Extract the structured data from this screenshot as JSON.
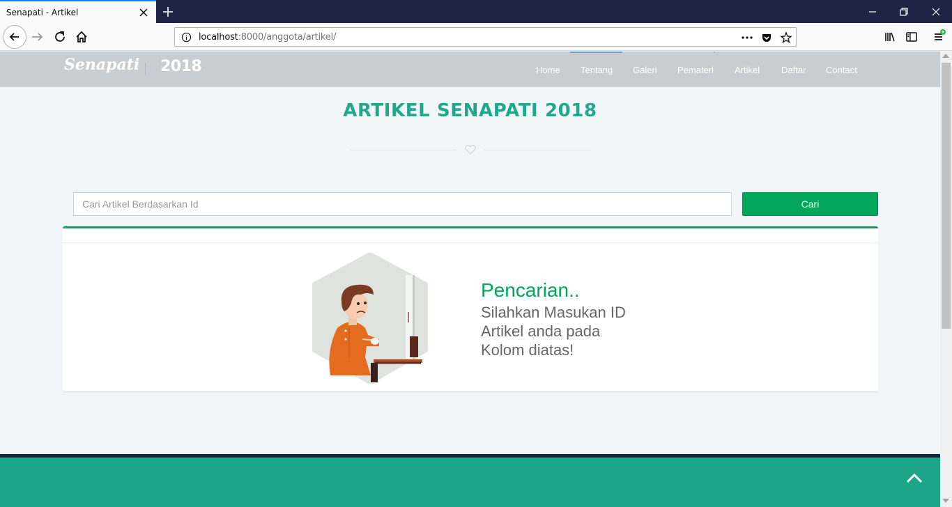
{
  "browser": {
    "tab_title": "Senapati - Artikel",
    "url_host": "localhost",
    "url_rest": ":8000/anggota/artikel/"
  },
  "header": {
    "brand": "Senapati",
    "year": "2018",
    "menu": [
      {
        "label": "Home"
      },
      {
        "label": "Tentang"
      },
      {
        "label": "Galeri"
      },
      {
        "label": "Pemateri"
      },
      {
        "label": "Artikel"
      },
      {
        "label": "Daftar"
      },
      {
        "label": "Contact"
      }
    ]
  },
  "main": {
    "title": "ARTIKEL SENAPATI 2018",
    "search": {
      "placeholder": "Cari Artikel Berdasarkan Id",
      "value": "",
      "button_label": "Cari"
    },
    "message": {
      "title": "Pencarian..",
      "lines": [
        "Silahkan Masukan ID",
        "Artikel anda pada",
        "Kolom diatas!"
      ]
    }
  },
  "colors": {
    "accent_green": "#00a65a",
    "title_teal": "#1fa88c",
    "footer": "#1da68a",
    "header_bg": "#c8cdd3"
  },
  "icons": [
    "close-icon",
    "plus-icon",
    "back-icon",
    "forward-icon",
    "reload-icon",
    "home-icon",
    "info-icon",
    "more-icon",
    "pocket-icon",
    "star-icon",
    "library-icon",
    "sidebar-icon",
    "menu-icon",
    "heart-icon",
    "chevron-up-icon"
  ]
}
